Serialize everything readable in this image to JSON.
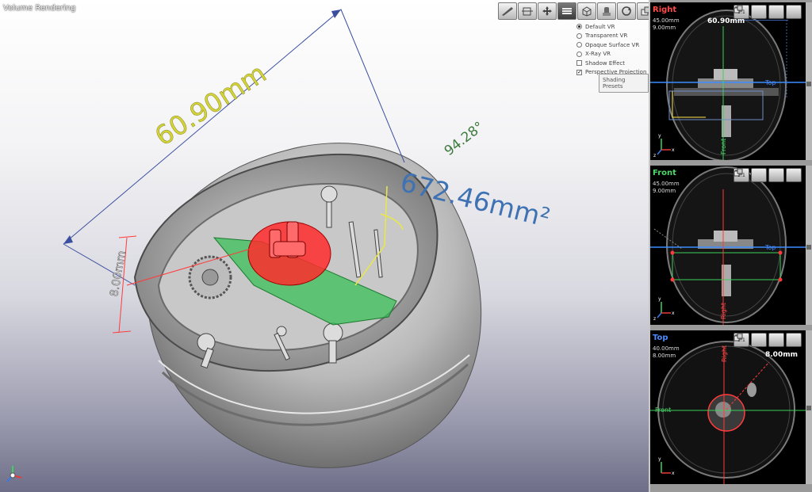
{
  "main_view": {
    "title": "Volume Rendering",
    "measurements": {
      "length": "60.90mm",
      "angle": "94.28°",
      "area": "672.46mm²",
      "depth": "8.00mm"
    }
  },
  "toolbar": {
    "buttons": [
      {
        "name": "ruler-tool",
        "active": false
      },
      {
        "name": "clip-tool",
        "active": false
      },
      {
        "name": "pan-tool",
        "active": false
      },
      {
        "name": "render-mode",
        "active": true
      },
      {
        "name": "cube-view",
        "active": false
      },
      {
        "name": "push-tool",
        "active": false
      },
      {
        "name": "rotate-view",
        "active": false
      },
      {
        "name": "layout-toggle",
        "active": false
      }
    ]
  },
  "render_options": {
    "radios": [
      {
        "label": "Default VR",
        "checked": true
      },
      {
        "label": "Transparent VR",
        "checked": false
      },
      {
        "label": "Opaque Surface VR",
        "checked": false
      },
      {
        "label": "X-Ray VR",
        "checked": false
      }
    ],
    "checkboxes": [
      {
        "label": "Shadow Effect",
        "checked": false
      },
      {
        "label": "Perspective Projection",
        "checked": true
      }
    ],
    "preset_button": "Shading Presets"
  },
  "side_panel": {
    "views": [
      {
        "label": "Right",
        "color": "#ff4a4a",
        "meta1": "45.00mm",
        "meta2": "9.00mm",
        "measure": "60.90mm",
        "crosshair_label": "Top",
        "axis_label": "Front",
        "axes": {
          "x": "x",
          "y": "y",
          "z": "z"
        }
      },
      {
        "label": "Front",
        "color": "#4fd86a",
        "meta1": "45.00mm",
        "meta2": "9.00mm",
        "crosshair_label": "Top",
        "axis_label": "Right",
        "axes": {
          "x": "x",
          "y": "y",
          "z": "z"
        }
      },
      {
        "label": "Top",
        "color": "#4a8cff",
        "meta1": "40.00mm",
        "meta2": "8.00mm",
        "measure": "8.00mm",
        "crosshair_label": "Front",
        "axis_label": "Right",
        "axes": {
          "x": "x",
          "y": "y"
        }
      }
    ],
    "buttons": [
      "1:1"
    ]
  },
  "colors": {
    "length": "#d4d43a",
    "angle": "#3e7a3e",
    "area": "#3f72b3",
    "depth": "#888888",
    "red_overlay": "#ff2b2b",
    "green_overlay": "#2fbf4f"
  }
}
